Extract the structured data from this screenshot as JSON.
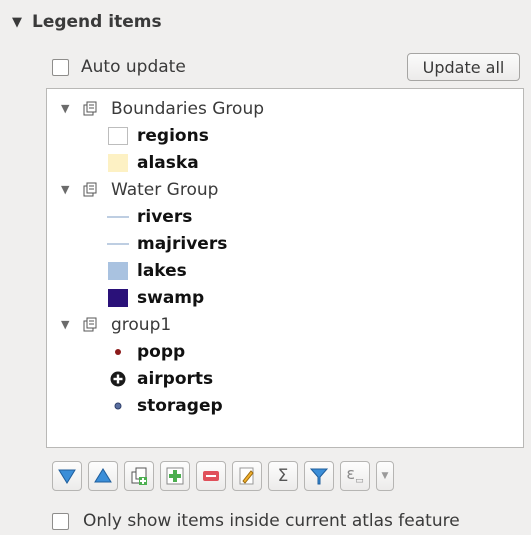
{
  "section": {
    "title": "Legend items",
    "collapse_glyph": "▼"
  },
  "auto_update": {
    "label": "Auto update",
    "checked": false
  },
  "update_all": {
    "label": "Update all"
  },
  "tree": {
    "groups": [
      {
        "label": "Boundaries Group",
        "expand_glyph": "▼",
        "layers": [
          {
            "label": "regions",
            "symbol": "fill",
            "color": "#ffffff",
            "stroke": "#bdbdbd"
          },
          {
            "label": "alaska",
            "symbol": "fill",
            "color": "#fdf1c4",
            "stroke": "#fdf1c4"
          }
        ]
      },
      {
        "label": "Water Group",
        "expand_glyph": "▼",
        "layers": [
          {
            "label": "rivers",
            "symbol": "line",
            "color": "#a9bdd8"
          },
          {
            "label": "majrivers",
            "symbol": "line",
            "color": "#a9bdd8"
          },
          {
            "label": "lakes",
            "symbol": "fill",
            "color": "#a9c2e0",
            "stroke": "#a9c2e0"
          },
          {
            "label": "swamp",
            "symbol": "fill",
            "color": "#2a1179",
            "stroke": "#2a1179"
          }
        ]
      },
      {
        "label": "group1",
        "expand_glyph": "▼",
        "layers": [
          {
            "label": "popp",
            "symbol": "dot",
            "color": "#8b1a1a"
          },
          {
            "label": "airports",
            "symbol": "airport",
            "color": "#1a1a1a"
          },
          {
            "label": "storagep",
            "symbol": "dot-outline",
            "color": "#5a6fa0"
          }
        ]
      }
    ]
  },
  "toolbar": {
    "buttons": [
      {
        "name": "move-down-icon",
        "kind": "triangle-down",
        "color": "#3b8ed8"
      },
      {
        "name": "move-up-icon",
        "kind": "triangle-up",
        "color": "#3b8ed8"
      },
      {
        "name": "add-group-icon",
        "kind": "group"
      },
      {
        "name": "add-item-icon",
        "kind": "plus",
        "color": "#4caf50"
      },
      {
        "name": "remove-item-icon",
        "kind": "minus",
        "color": "#e0505a"
      },
      {
        "name": "edit-item-icon",
        "kind": "pencil",
        "color": "#f2b12e"
      },
      {
        "name": "sum-icon",
        "kind": "sigma",
        "label": "Σ"
      },
      {
        "name": "filter-icon",
        "kind": "filter",
        "color": "#3b8ed8"
      },
      {
        "name": "expression-icon",
        "kind": "epsilon",
        "label": "ε"
      }
    ]
  },
  "atlas_filter": {
    "label": "Only show items inside current atlas feature",
    "checked": false
  }
}
